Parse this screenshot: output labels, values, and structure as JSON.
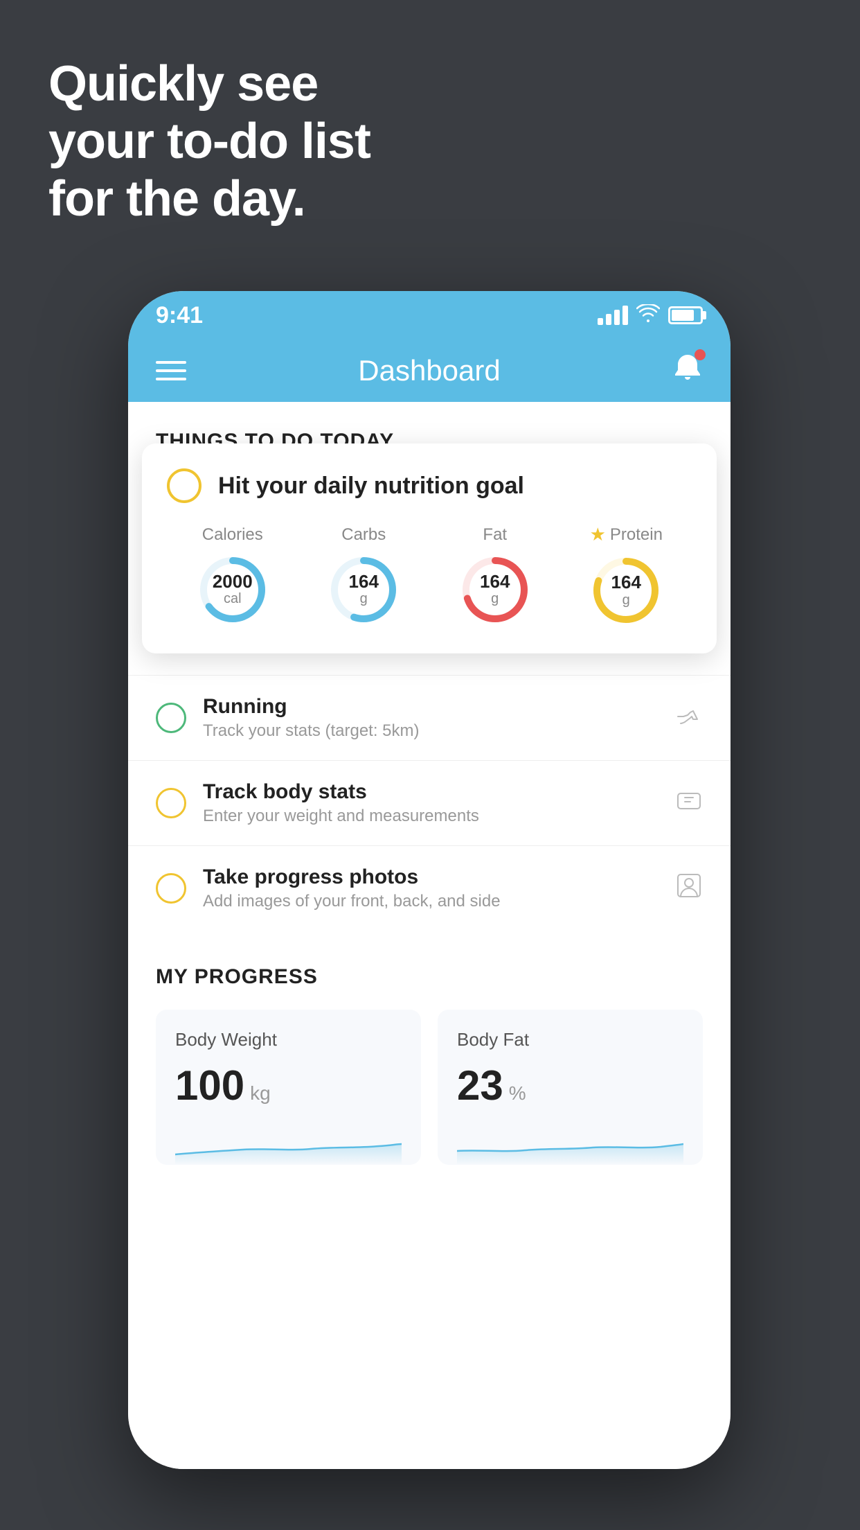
{
  "hero": {
    "line1": "Quickly see",
    "line2": "your to-do list",
    "line3": "for the day."
  },
  "statusBar": {
    "time": "9:41"
  },
  "navBar": {
    "title": "Dashboard"
  },
  "thingsToDo": {
    "sectionTitle": "THINGS TO DO TODAY"
  },
  "nutritionCard": {
    "checkLabel": "",
    "title": "Hit your daily nutrition goal",
    "stats": [
      {
        "label": "Calories",
        "value": "2000",
        "unit": "cal",
        "color": "#5bbce4",
        "pct": 65
      },
      {
        "label": "Carbs",
        "value": "164",
        "unit": "g",
        "color": "#5bbce4",
        "pct": 55
      },
      {
        "label": "Fat",
        "value": "164",
        "unit": "g",
        "color": "#e85454",
        "pct": 70
      },
      {
        "label": "Protein",
        "value": "164",
        "unit": "g",
        "color": "#f0c430",
        "pct": 80,
        "star": true
      }
    ]
  },
  "todoItems": [
    {
      "name": "Running",
      "sub": "Track your stats (target: 5km)",
      "circleColor": "green",
      "icon": "👟"
    },
    {
      "name": "Track body stats",
      "sub": "Enter your weight and measurements",
      "circleColor": "yellow",
      "icon": "⚖"
    },
    {
      "name": "Take progress photos",
      "sub": "Add images of your front, back, and side",
      "circleColor": "yellow",
      "icon": "👤"
    }
  ],
  "myProgress": {
    "sectionTitle": "MY PROGRESS",
    "cards": [
      {
        "title": "Body Weight",
        "value": "100",
        "unit": "kg"
      },
      {
        "title": "Body Fat",
        "value": "23",
        "unit": "%"
      }
    ]
  },
  "colors": {
    "background": "#3a3d42",
    "navBlue": "#5bbce4",
    "accent_yellow": "#f0c430",
    "accent_green": "#4db87a",
    "accent_red": "#e85454"
  }
}
